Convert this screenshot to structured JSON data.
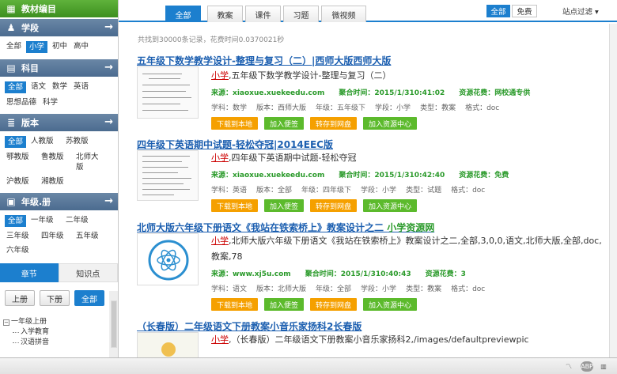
{
  "sidebar": {
    "header": {
      "title": "教材编目"
    },
    "stage": {
      "title": "学段",
      "options": [
        "全部",
        "小学",
        "初中",
        "高中"
      ],
      "selected": 1
    },
    "subject": {
      "title": "科目",
      "options": [
        "全部",
        "语文",
        "数学",
        "英语",
        "思想品德",
        "科学"
      ],
      "selected": 0
    },
    "edition": {
      "title": "版本",
      "options": [
        "全部",
        "人教版",
        "苏教版",
        "鄂教版",
        "鲁教版",
        "北师大版",
        "沪教版",
        "湘教版"
      ],
      "selected": 0
    },
    "grade": {
      "title": "年级.册",
      "options": [
        "全部",
        "一年级",
        "二年级",
        "三年级",
        "四年级",
        "五年级",
        "六年级"
      ],
      "selected": 0
    },
    "tabs": [
      "章节",
      "知识点"
    ],
    "volumes": [
      "上册",
      "下册",
      "全部"
    ],
    "tree": {
      "root": "一年级上册",
      "children": [
        "入学教育",
        "汉语拼音"
      ]
    }
  },
  "topbar": {
    "tabs": [
      "全部",
      "教案",
      "课件",
      "习题",
      "微视频"
    ],
    "fee_all": "全部",
    "fee_free": "免费",
    "site_filter": "站点过滤"
  },
  "stats": "共找到30000条记录，花费时间0.0370021秒",
  "results": [
    {
      "title": "五年级下数学教学设计-整理与复习（二）|西师大版西师大版",
      "title_hl": "",
      "desc_kw": "小学",
      "desc": ",五年级下数学教学设计-整理与复习（二）",
      "source_label": "来源：",
      "source": "xiaoxue.xuekeedu.com",
      "time_label": "聚合时间：",
      "time": "2015/1/310:41:02",
      "fee_label": "资源花费：",
      "fee": "网校通专供",
      "props": [
        "学科：数学",
        "版本：西师大版",
        "年级：五年级下",
        "学段：小学",
        "类型：教案",
        "格式：doc"
      ]
    },
    {
      "title": "四年级下英语期中试题-轻松夺冠|2014EEC版",
      "title_hl": "",
      "desc_kw": "小学",
      "desc": ",四年级下英语期中试题-轻松夺冠",
      "source_label": "来源：",
      "source": "xiaoxue.xuekeedu.com",
      "time_label": "聚合时间：",
      "time": "2015/1/310:42:40",
      "fee_label": "资源花费：",
      "fee": "免费",
      "props": [
        "学科：英语",
        "版本：全部",
        "年级：四年级下",
        "学段：小学",
        "类型：试题",
        "格式：doc"
      ]
    },
    {
      "title": "北师大版六年级下册语文《我站在铁索桥上》教案设计之二 ",
      "title_hl": "小学资源网",
      "desc_kw": "小学",
      "desc": ",北师大版六年级下册语文《我站在铁索桥上》教案设计之二,全部,3,0,0,语文,北师大版,全部,doc,教案,78",
      "source_label": "来源：",
      "source": "www.xj5u.com",
      "time_label": "聚合时间：",
      "time": "2015/1/310:40:43",
      "fee_label": "资源花费：",
      "fee": "3",
      "props": [
        "学科：语文",
        "版本：北师大版",
        "年级：全部",
        "学段：小学",
        "类型：教案",
        "格式：doc"
      ]
    },
    {
      "title": "（长春版）二年级语文下册教案小音乐家扬科2长春版",
      "title_hl": "",
      "desc_kw": "小学",
      "desc": ",（长春版）二年级语文下册教案小音乐家扬科2,/images/defaultpreviewpic"
    }
  ],
  "buttons": {
    "download": "下载到本地",
    "note": "加入便签",
    "cloud": "转存到网盘",
    "center": "加入资源中心"
  },
  "colors": {
    "accent": "#1c7fce",
    "sidebar_header": "#4b6b8f",
    "green": "#5cba2c",
    "orange": "#f5a000",
    "link": "#1c5fb0"
  }
}
